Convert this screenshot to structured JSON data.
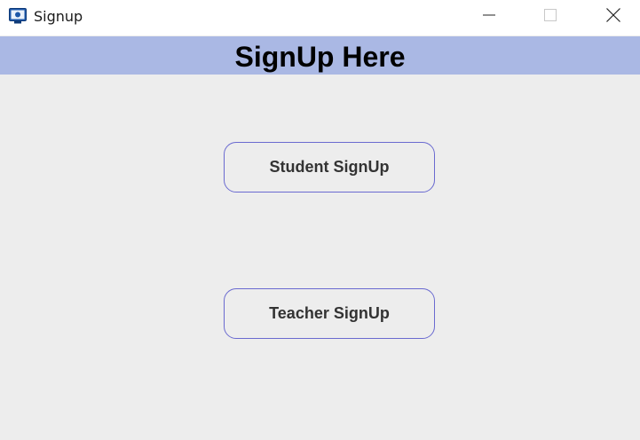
{
  "window": {
    "title": "Signup",
    "app_icon": "java-app-icon",
    "controls": {
      "minimize_icon": "minimize-icon",
      "maximize_icon": "maximize-icon",
      "close_icon": "close-icon"
    }
  },
  "header": {
    "title": "SignUp Here",
    "background": "#aab8e4"
  },
  "buttons": {
    "student": "Student SignUp",
    "teacher": "Teacher SignUp",
    "border_color": "#6a6ad0"
  }
}
